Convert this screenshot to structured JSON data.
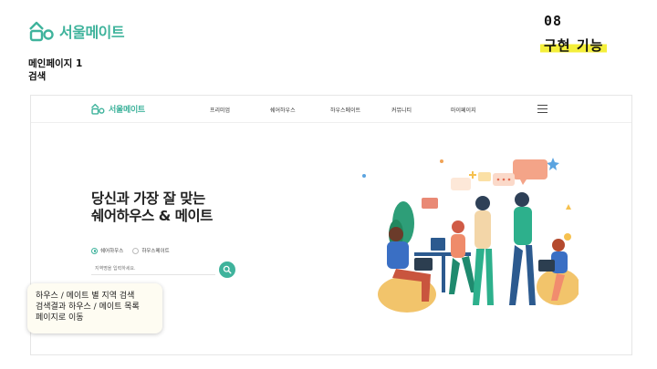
{
  "slide": {
    "brand": "서울메이트",
    "subtitle_lines": [
      "메인페이지 1",
      "검색"
    ],
    "section_number": "08",
    "section_title": "구현 기능"
  },
  "site": {
    "brand": "서울메이트",
    "nav_items": [
      "프리미엄",
      "쉐어하우스",
      "하우스메이트",
      "커뮤니티",
      "마이페이지"
    ],
    "hero_title_lines": [
      "당신과 가장 잘 맞는",
      "쉐어하우스 & 메이트"
    ],
    "radio_options": [
      {
        "label": "쉐어하우스",
        "selected": true
      },
      {
        "label": "하우스메이트",
        "selected": false
      }
    ],
    "search_placeholder": "지역명을 입력하세요.",
    "accent_color": "#3fb39c",
    "menu_icon": "hamburger-menu-icon",
    "search_icon": "search-icon"
  },
  "note": {
    "lines": [
      "하우스 / 메이트 별 지역 검색",
      "검색결과 하우스 / 메이트 목록",
      "페이지로 이동"
    ]
  }
}
